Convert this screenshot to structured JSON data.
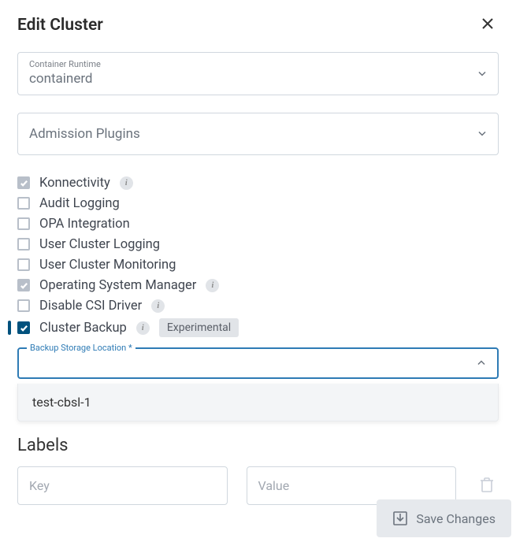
{
  "header": {
    "title": "Edit Cluster"
  },
  "containerRuntime": {
    "label": "Container Runtime",
    "value": "containerd"
  },
  "admissionPlugins": {
    "placeholder": "Admission Plugins"
  },
  "checkboxes": [
    {
      "label": "Konnectivity",
      "checked": true,
      "disabled": true,
      "info": true
    },
    {
      "label": "Audit Logging",
      "checked": false,
      "disabled": false,
      "info": false
    },
    {
      "label": "OPA Integration",
      "checked": false,
      "disabled": false,
      "info": false
    },
    {
      "label": "User Cluster Logging",
      "checked": false,
      "disabled": false,
      "info": false
    },
    {
      "label": "User Cluster Monitoring",
      "checked": false,
      "disabled": false,
      "info": false
    },
    {
      "label": "Operating System Manager",
      "checked": true,
      "disabled": true,
      "info": true
    },
    {
      "label": "Disable CSI Driver",
      "checked": false,
      "disabled": false,
      "info": true
    },
    {
      "label": "Cluster Backup",
      "checked": true,
      "disabled": false,
      "info": true,
      "tag": "Experimental",
      "indicator": true
    }
  ],
  "backupStorageLocation": {
    "label": "Backup Storage Location",
    "required": "*",
    "options": [
      "test-cbsl-1"
    ]
  },
  "labels": {
    "heading": "Labels",
    "keyPlaceholder": "Key",
    "valuePlaceholder": "Value"
  },
  "footer": {
    "saveLabel": "Save Changes"
  }
}
